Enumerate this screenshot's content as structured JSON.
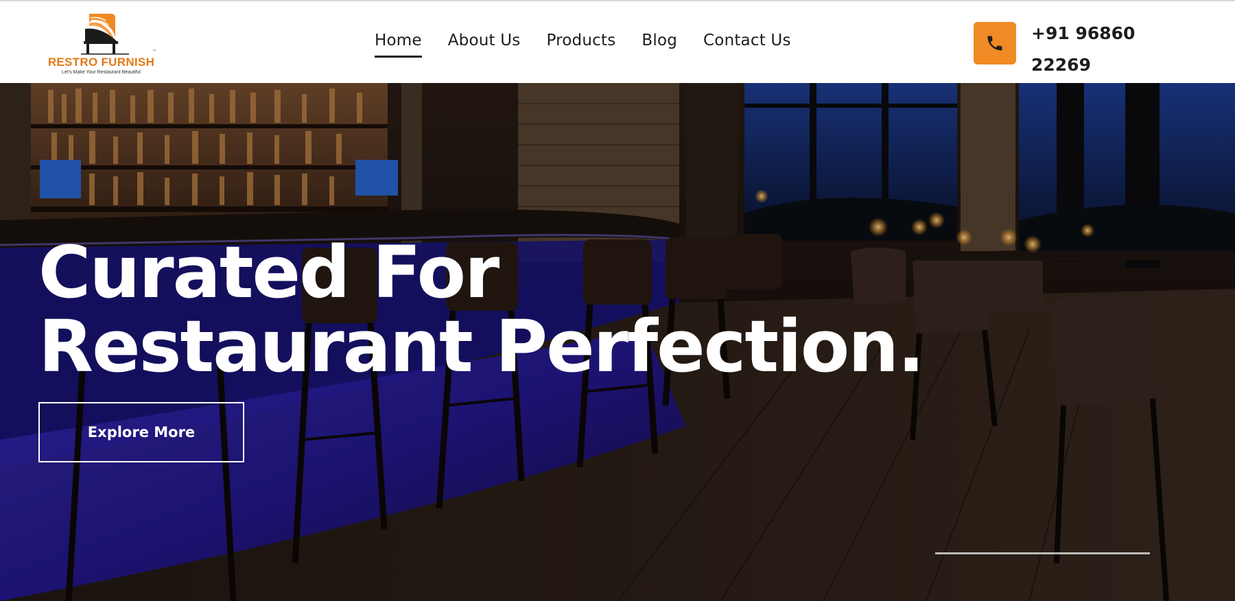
{
  "header": {
    "logo": {
      "name": "RESTRO FURNISH",
      "tagline": "Let's Make Your Restaurant Beautiful",
      "trademark": "™",
      "icon": "chair-logo-icon"
    },
    "nav": {
      "items": [
        {
          "label": "Home",
          "active": true
        },
        {
          "label": "About Us",
          "active": false
        },
        {
          "label": "Products",
          "active": false
        },
        {
          "label": "Blog",
          "active": false
        },
        {
          "label": "Contact Us",
          "active": false
        }
      ]
    },
    "contact": {
      "phone_icon": "phone-icon",
      "phone_line1": "+91 96860",
      "phone_line2": "22269"
    }
  },
  "hero": {
    "headline_line1": "Curated For",
    "headline_line2": "Restaurant Perfection.",
    "cta_label": "Explore More"
  },
  "colors": {
    "accent": "#f08a24",
    "brand_text": "#e07a18",
    "nav_text": "#1d1d1d",
    "hero_text": "#ffffff"
  }
}
